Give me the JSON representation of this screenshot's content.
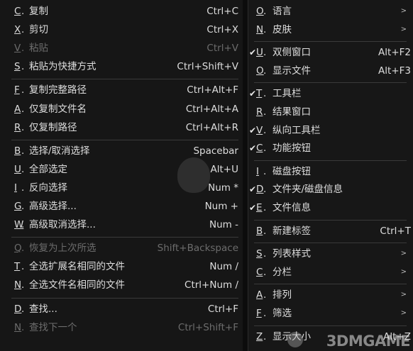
{
  "left_menu": {
    "groups": [
      [
        {
          "mn": "C",
          "label": "复制",
          "shortcut": "Ctrl+C",
          "disabled": false
        },
        {
          "mn": "X",
          "label": "剪切",
          "shortcut": "Ctrl+X",
          "disabled": false
        },
        {
          "mn": "V",
          "label": "粘贴",
          "shortcut": "Ctrl+V",
          "disabled": true
        },
        {
          "mn": "S",
          "label": "粘贴为快捷方式",
          "shortcut": "Ctrl+Shift+V",
          "disabled": false
        }
      ],
      [
        {
          "mn": "F",
          "label": "复制完整路径",
          "shortcut": "Ctrl+Alt+F",
          "disabled": false
        },
        {
          "mn": "A",
          "label": "仅复制文件名",
          "shortcut": "Ctrl+Alt+A",
          "disabled": false
        },
        {
          "mn": "R",
          "label": "仅复制路径",
          "shortcut": "Ctrl+Alt+R",
          "disabled": false
        }
      ],
      [
        {
          "mn": "B",
          "label": "选择/取消选择",
          "shortcut": "Spacebar",
          "disabled": false
        },
        {
          "mn": "U",
          "label": "全部选定",
          "shortcut": "Alt+U",
          "disabled": false
        },
        {
          "mn": "I",
          "label": "反向选择",
          "shortcut": "Num *",
          "disabled": false
        },
        {
          "mn": "G",
          "label": "高级选择...",
          "shortcut": "Num +",
          "disabled": false
        },
        {
          "mn": "W",
          "label": "高级取消选择...",
          "shortcut": "Num -",
          "disabled": false
        }
      ],
      [
        {
          "mn": "Q",
          "label": "恢复为上次所选",
          "shortcut": "Shift+Backspace",
          "disabled": true
        },
        {
          "mn": "T",
          "label": "全选扩展名相同的文件",
          "shortcut": "Num /",
          "disabled": false
        },
        {
          "mn": "N",
          "label": "全选文件名相同的文件",
          "shortcut": "Ctrl+Num /",
          "disabled": false
        }
      ],
      [
        {
          "mn": "D",
          "label": "查找...",
          "shortcut": "Ctrl+F",
          "disabled": false
        },
        {
          "mn": "N",
          "label": "查找下一个",
          "shortcut": "Ctrl+Shift+F",
          "disabled": true
        }
      ]
    ]
  },
  "right_menu": {
    "groups": [
      [
        {
          "mn": "O",
          "label": "语言",
          "shortcut": "",
          "checked": false,
          "submenu": true
        },
        {
          "mn": "N",
          "label": "皮肤",
          "shortcut": "",
          "checked": false,
          "submenu": true
        }
      ],
      [
        {
          "mn": "U",
          "label": "双侧窗口",
          "shortcut": "Alt+F2",
          "checked": true,
          "submenu": false
        },
        {
          "mn": "O",
          "label": "显示文件",
          "shortcut": "Alt+F3",
          "checked": false,
          "submenu": false
        }
      ],
      [
        {
          "mn": "T",
          "label": "工具栏",
          "shortcut": "",
          "checked": true,
          "submenu": false
        },
        {
          "mn": "R",
          "label": "结果窗口",
          "shortcut": "",
          "checked": false,
          "submenu": false
        },
        {
          "mn": "V",
          "label": "纵向工具栏",
          "shortcut": "",
          "checked": true,
          "submenu": false
        },
        {
          "mn": "C",
          "label": "功能按钮",
          "shortcut": "",
          "checked": true,
          "submenu": false
        }
      ],
      [
        {
          "mn": "I",
          "label": "磁盘按钮",
          "shortcut": "",
          "checked": false,
          "submenu": false
        },
        {
          "mn": "D",
          "label": "文件夹/磁盘信息",
          "shortcut": "",
          "checked": true,
          "submenu": false
        },
        {
          "mn": "E",
          "label": "文件信息",
          "shortcut": "",
          "checked": true,
          "submenu": false
        }
      ],
      [
        {
          "mn": "B",
          "label": "新建标签",
          "shortcut": "Ctrl+T",
          "checked": false,
          "submenu": false
        }
      ],
      [
        {
          "mn": "S",
          "label": "列表样式",
          "shortcut": "",
          "checked": false,
          "submenu": true
        },
        {
          "mn": "C",
          "label": "分栏",
          "shortcut": "",
          "checked": false,
          "submenu": true
        }
      ],
      [
        {
          "mn": "A",
          "label": "排列",
          "shortcut": "",
          "checked": false,
          "submenu": true
        },
        {
          "mn": "F",
          "label": "筛选",
          "shortcut": "",
          "checked": false,
          "submenu": true
        }
      ],
      [
        {
          "mn": "Z",
          "label": "显示大小",
          "shortcut": "Alt+Z",
          "checked": false,
          "submenu": false
        }
      ]
    ]
  },
  "icons": {
    "check": "check-icon",
    "submenu": "chevron-right-icon"
  },
  "watermark": {
    "text": "3DMGAME"
  },
  "colors": {
    "background": "#161616",
    "text": "#dedede",
    "disabled": "#6c6c6c",
    "separator": "#3a3a3a"
  }
}
